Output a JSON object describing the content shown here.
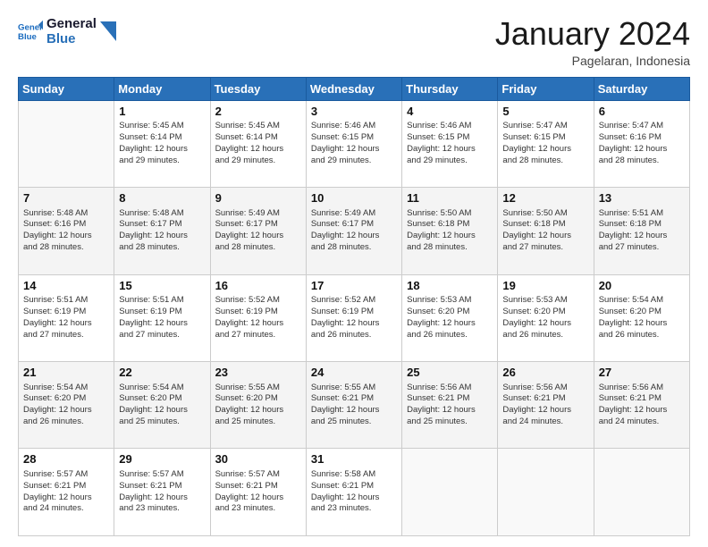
{
  "header": {
    "logo_line1": "General",
    "logo_line2": "Blue",
    "month": "January 2024",
    "location": "Pagelaran, Indonesia"
  },
  "weekdays": [
    "Sunday",
    "Monday",
    "Tuesday",
    "Wednesday",
    "Thursday",
    "Friday",
    "Saturday"
  ],
  "weeks": [
    [
      {
        "day": "",
        "info": ""
      },
      {
        "day": "1",
        "info": "Sunrise: 5:45 AM\nSunset: 6:14 PM\nDaylight: 12 hours\nand 29 minutes."
      },
      {
        "day": "2",
        "info": "Sunrise: 5:45 AM\nSunset: 6:14 PM\nDaylight: 12 hours\nand 29 minutes."
      },
      {
        "day": "3",
        "info": "Sunrise: 5:46 AM\nSunset: 6:15 PM\nDaylight: 12 hours\nand 29 minutes."
      },
      {
        "day": "4",
        "info": "Sunrise: 5:46 AM\nSunset: 6:15 PM\nDaylight: 12 hours\nand 29 minutes."
      },
      {
        "day": "5",
        "info": "Sunrise: 5:47 AM\nSunset: 6:15 PM\nDaylight: 12 hours\nand 28 minutes."
      },
      {
        "day": "6",
        "info": "Sunrise: 5:47 AM\nSunset: 6:16 PM\nDaylight: 12 hours\nand 28 minutes."
      }
    ],
    [
      {
        "day": "7",
        "info": "Sunrise: 5:48 AM\nSunset: 6:16 PM\nDaylight: 12 hours\nand 28 minutes."
      },
      {
        "day": "8",
        "info": "Sunrise: 5:48 AM\nSunset: 6:17 PM\nDaylight: 12 hours\nand 28 minutes."
      },
      {
        "day": "9",
        "info": "Sunrise: 5:49 AM\nSunset: 6:17 PM\nDaylight: 12 hours\nand 28 minutes."
      },
      {
        "day": "10",
        "info": "Sunrise: 5:49 AM\nSunset: 6:17 PM\nDaylight: 12 hours\nand 28 minutes."
      },
      {
        "day": "11",
        "info": "Sunrise: 5:50 AM\nSunset: 6:18 PM\nDaylight: 12 hours\nand 28 minutes."
      },
      {
        "day": "12",
        "info": "Sunrise: 5:50 AM\nSunset: 6:18 PM\nDaylight: 12 hours\nand 27 minutes."
      },
      {
        "day": "13",
        "info": "Sunrise: 5:51 AM\nSunset: 6:18 PM\nDaylight: 12 hours\nand 27 minutes."
      }
    ],
    [
      {
        "day": "14",
        "info": "Sunrise: 5:51 AM\nSunset: 6:19 PM\nDaylight: 12 hours\nand 27 minutes."
      },
      {
        "day": "15",
        "info": "Sunrise: 5:51 AM\nSunset: 6:19 PM\nDaylight: 12 hours\nand 27 minutes."
      },
      {
        "day": "16",
        "info": "Sunrise: 5:52 AM\nSunset: 6:19 PM\nDaylight: 12 hours\nand 27 minutes."
      },
      {
        "day": "17",
        "info": "Sunrise: 5:52 AM\nSunset: 6:19 PM\nDaylight: 12 hours\nand 26 minutes."
      },
      {
        "day": "18",
        "info": "Sunrise: 5:53 AM\nSunset: 6:20 PM\nDaylight: 12 hours\nand 26 minutes."
      },
      {
        "day": "19",
        "info": "Sunrise: 5:53 AM\nSunset: 6:20 PM\nDaylight: 12 hours\nand 26 minutes."
      },
      {
        "day": "20",
        "info": "Sunrise: 5:54 AM\nSunset: 6:20 PM\nDaylight: 12 hours\nand 26 minutes."
      }
    ],
    [
      {
        "day": "21",
        "info": "Sunrise: 5:54 AM\nSunset: 6:20 PM\nDaylight: 12 hours\nand 26 minutes."
      },
      {
        "day": "22",
        "info": "Sunrise: 5:54 AM\nSunset: 6:20 PM\nDaylight: 12 hours\nand 25 minutes."
      },
      {
        "day": "23",
        "info": "Sunrise: 5:55 AM\nSunset: 6:20 PM\nDaylight: 12 hours\nand 25 minutes."
      },
      {
        "day": "24",
        "info": "Sunrise: 5:55 AM\nSunset: 6:21 PM\nDaylight: 12 hours\nand 25 minutes."
      },
      {
        "day": "25",
        "info": "Sunrise: 5:56 AM\nSunset: 6:21 PM\nDaylight: 12 hours\nand 25 minutes."
      },
      {
        "day": "26",
        "info": "Sunrise: 5:56 AM\nSunset: 6:21 PM\nDaylight: 12 hours\nand 24 minutes."
      },
      {
        "day": "27",
        "info": "Sunrise: 5:56 AM\nSunset: 6:21 PM\nDaylight: 12 hours\nand 24 minutes."
      }
    ],
    [
      {
        "day": "28",
        "info": "Sunrise: 5:57 AM\nSunset: 6:21 PM\nDaylight: 12 hours\nand 24 minutes."
      },
      {
        "day": "29",
        "info": "Sunrise: 5:57 AM\nSunset: 6:21 PM\nDaylight: 12 hours\nand 23 minutes."
      },
      {
        "day": "30",
        "info": "Sunrise: 5:57 AM\nSunset: 6:21 PM\nDaylight: 12 hours\nand 23 minutes."
      },
      {
        "day": "31",
        "info": "Sunrise: 5:58 AM\nSunset: 6:21 PM\nDaylight: 12 hours\nand 23 minutes."
      },
      {
        "day": "",
        "info": ""
      },
      {
        "day": "",
        "info": ""
      },
      {
        "day": "",
        "info": ""
      }
    ]
  ],
  "row_shades": [
    false,
    true,
    false,
    true,
    false
  ]
}
